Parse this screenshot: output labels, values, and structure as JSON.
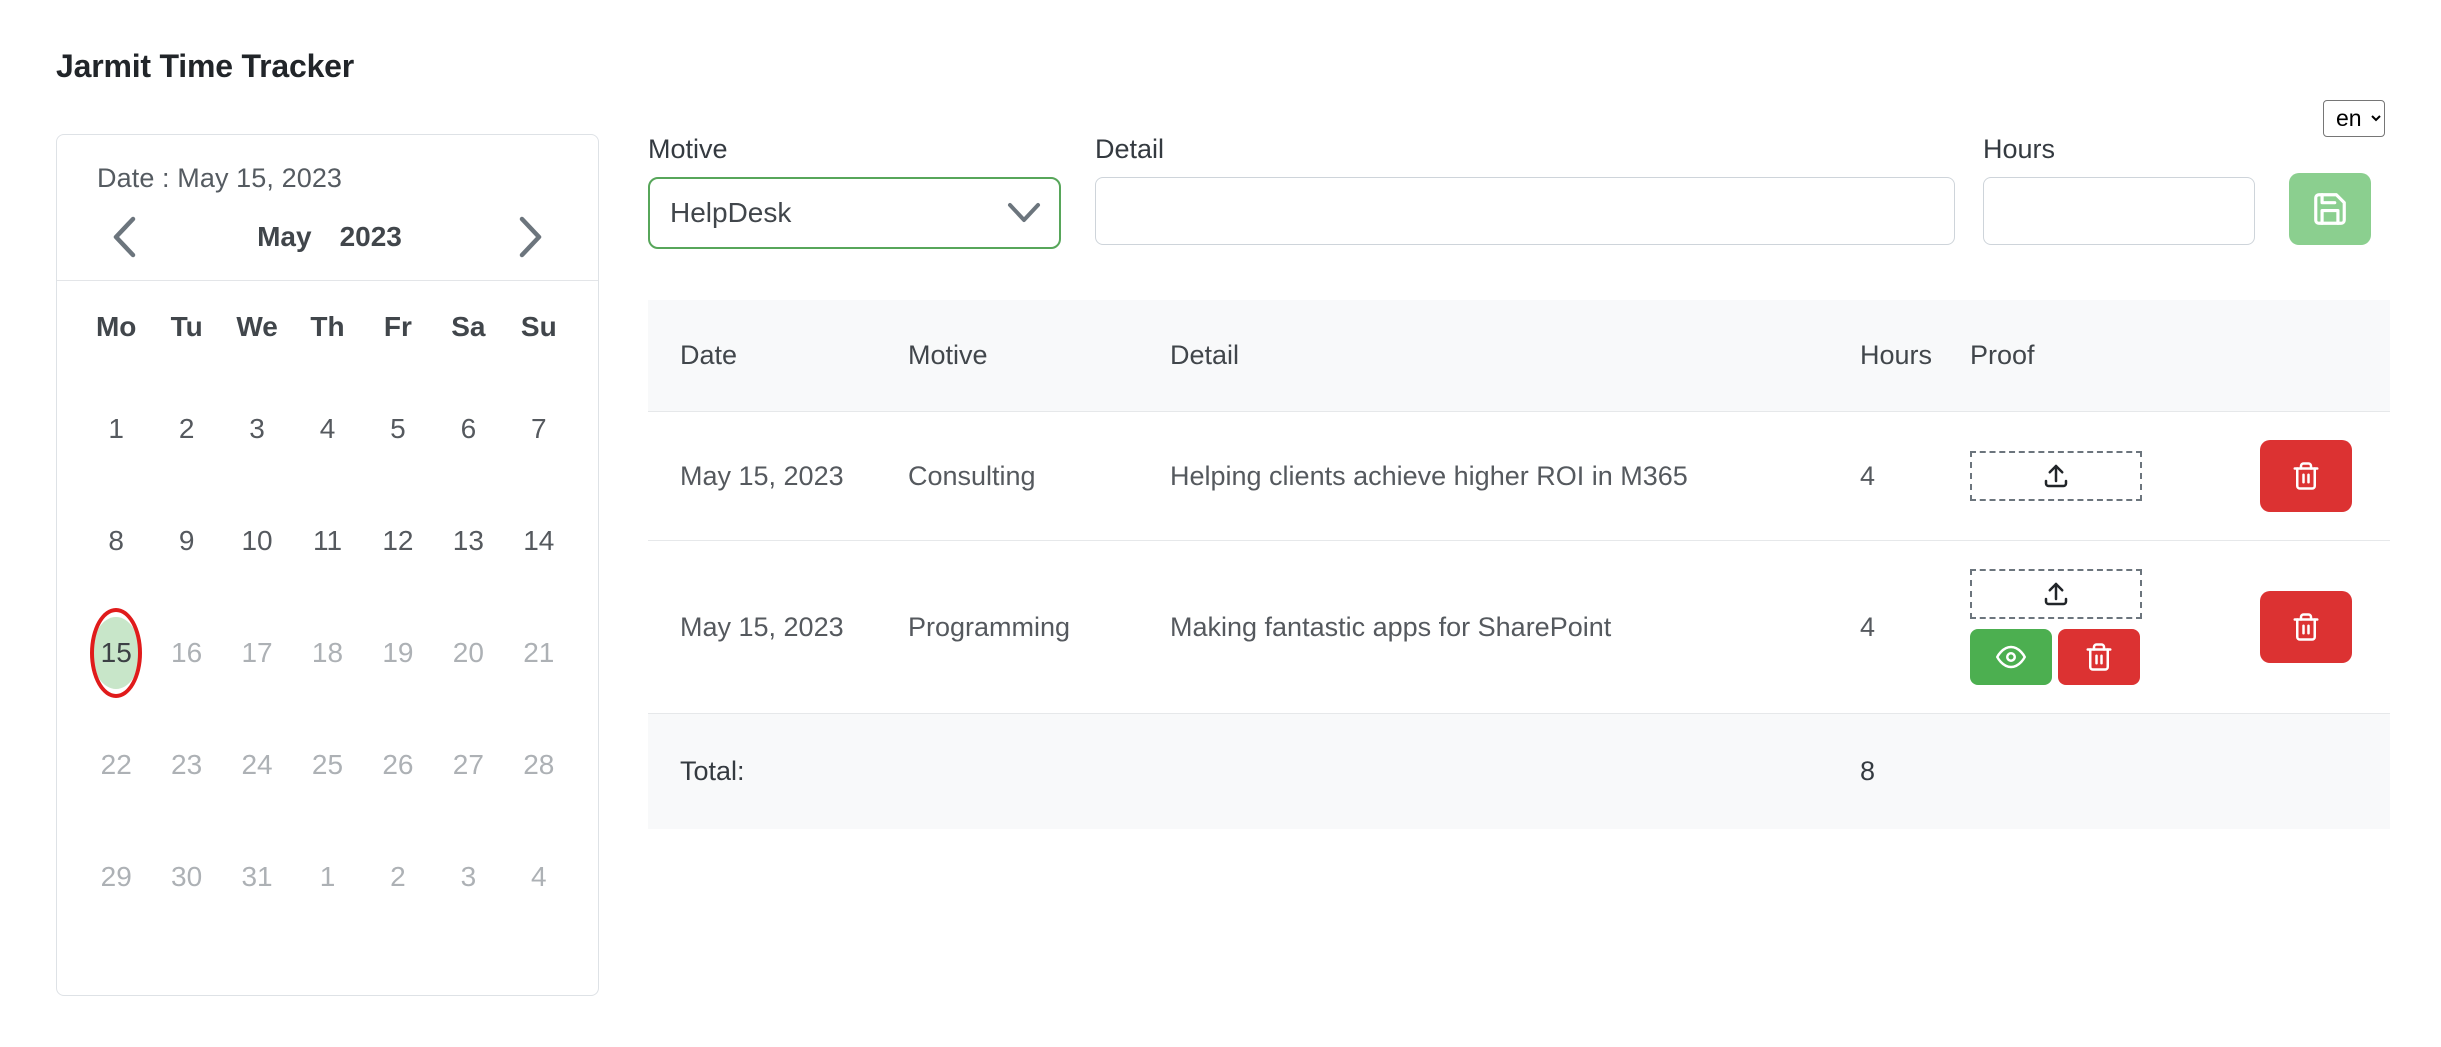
{
  "header": {
    "title": "Jarmit Time Tracker",
    "language": {
      "selected": "en",
      "options": [
        "en"
      ]
    }
  },
  "calendar": {
    "date_label": "Date : May 15, 2023",
    "prev_icon": "chevron-left-icon",
    "next_icon": "chevron-right-icon",
    "month": "May",
    "year": "2023",
    "day_headers": [
      "Mo",
      "Tu",
      "We",
      "Th",
      "Fr",
      "Sa",
      "Su"
    ],
    "selected_day": 15,
    "annotation": {
      "shape": "ellipse",
      "color": "#e01b1b",
      "target_day": 15
    },
    "selected_bg_color": "#c8e6c9",
    "weeks": [
      [
        {
          "d": "1",
          "muted": false
        },
        {
          "d": "2",
          "muted": false
        },
        {
          "d": "3",
          "muted": false
        },
        {
          "d": "4",
          "muted": false
        },
        {
          "d": "5",
          "muted": false
        },
        {
          "d": "6",
          "muted": false
        },
        {
          "d": "7",
          "muted": false
        }
      ],
      [
        {
          "d": "8",
          "muted": false
        },
        {
          "d": "9",
          "muted": false
        },
        {
          "d": "10",
          "muted": false
        },
        {
          "d": "11",
          "muted": false
        },
        {
          "d": "12",
          "muted": false
        },
        {
          "d": "13",
          "muted": false
        },
        {
          "d": "14",
          "muted": false
        }
      ],
      [
        {
          "d": "15",
          "muted": false,
          "selected": true
        },
        {
          "d": "16",
          "muted": true
        },
        {
          "d": "17",
          "muted": true
        },
        {
          "d": "18",
          "muted": true
        },
        {
          "d": "19",
          "muted": true
        },
        {
          "d": "20",
          "muted": true
        },
        {
          "d": "21",
          "muted": true
        }
      ],
      [
        {
          "d": "22",
          "muted": true
        },
        {
          "d": "23",
          "muted": true
        },
        {
          "d": "24",
          "muted": true
        },
        {
          "d": "25",
          "muted": true
        },
        {
          "d": "26",
          "muted": true
        },
        {
          "d": "27",
          "muted": true
        },
        {
          "d": "28",
          "muted": true
        }
      ],
      [
        {
          "d": "29",
          "muted": true
        },
        {
          "d": "30",
          "muted": true
        },
        {
          "d": "31",
          "muted": true
        },
        {
          "d": "1",
          "muted": true
        },
        {
          "d": "2",
          "muted": true
        },
        {
          "d": "3",
          "muted": true
        },
        {
          "d": "4",
          "muted": true
        }
      ]
    ]
  },
  "form": {
    "motive": {
      "label": "Motive",
      "value": "HelpDesk",
      "chevron_icon": "chevron-down-icon",
      "border_color": "#57a65a"
    },
    "detail": {
      "label": "Detail",
      "value": "",
      "placeholder": ""
    },
    "hours": {
      "label": "Hours",
      "value": "",
      "placeholder": ""
    },
    "save": {
      "icon": "save-floppy-icon",
      "color": "#8bcf8f",
      "label": ""
    }
  },
  "table": {
    "columns": [
      "Date",
      "Motive",
      "Detail",
      "Hours",
      "Proof"
    ],
    "rows": [
      {
        "date": "May 15, 2023",
        "motive": "Consulting",
        "detail": "Helping clients achieve higher ROI in M365",
        "hours": "4",
        "proof": {
          "upload_icon": "upload-icon",
          "has_view": false,
          "has_proof_delete": false
        },
        "delete_icon": "trash-icon"
      },
      {
        "date": "May 15, 2023",
        "motive": "Programming",
        "detail": "Making fantastic apps for SharePoint",
        "hours": "4",
        "proof": {
          "upload_icon": "upload-icon",
          "has_view": true,
          "view_icon": "eye-icon",
          "has_proof_delete": true,
          "proof_delete_icon": "trash-icon"
        },
        "delete_icon": "trash-icon"
      }
    ],
    "total": {
      "label": "Total:",
      "value": "8"
    }
  },
  "colors": {
    "accent_green": "#4caf50",
    "danger_red": "#dc3232",
    "muted_green": "#8bcf8f",
    "header_bg": "#f8f9fa"
  }
}
